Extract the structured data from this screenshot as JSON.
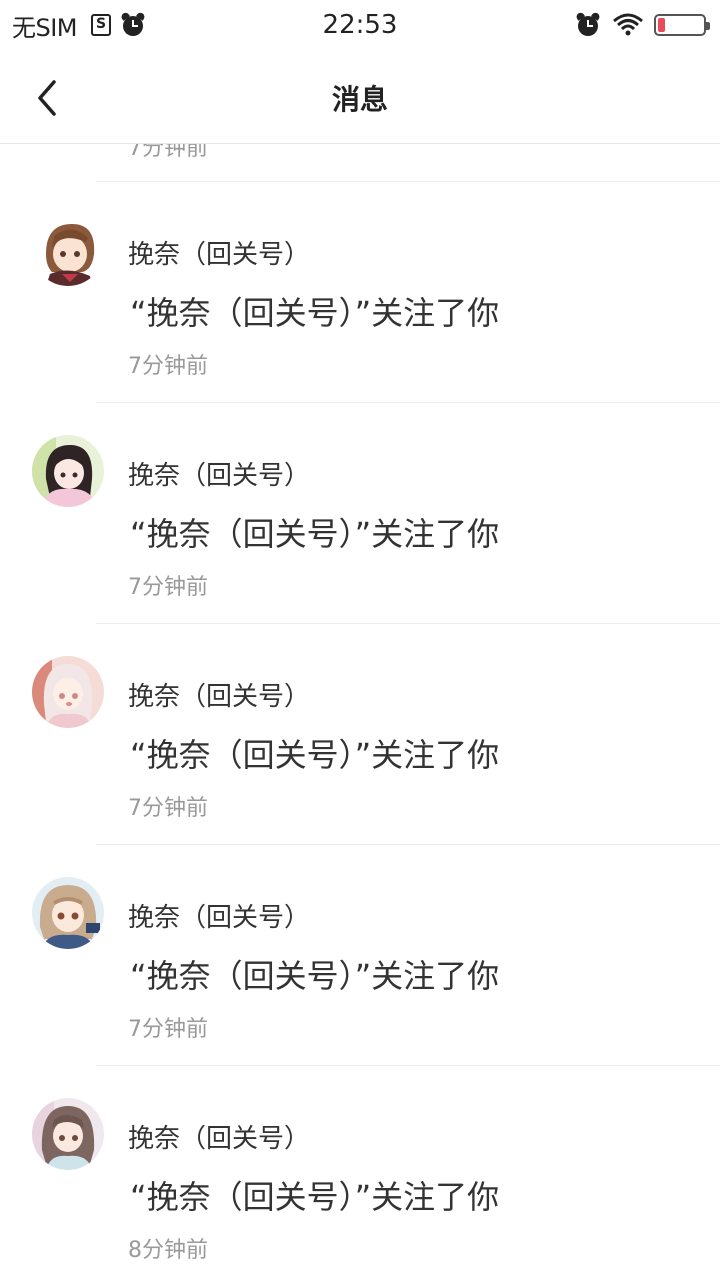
{
  "status_bar": {
    "carrier": "无SIM",
    "s_icon_label": "S",
    "time": "22:53",
    "battery_level": 0.15,
    "colors": {
      "battery_fill": "#e94b5b"
    }
  },
  "header": {
    "title": "消息",
    "back_icon": "chevron-left-icon"
  },
  "partial_item": {
    "time": "7分钟前"
  },
  "messages": [
    {
      "name": "挽奈（回关号）",
      "text": "“挽奈（回关号）”关注了你",
      "time": "7分钟前"
    },
    {
      "name": "挽奈（回关号）",
      "text": "“挽奈（回关号）”关注了你",
      "time": "7分钟前"
    },
    {
      "name": "挽奈（回关号）",
      "text": "“挽奈（回关号）”关注了你",
      "time": "7分钟前"
    },
    {
      "name": "挽奈（回关号）",
      "text": "“挽奈（回关号）”关注了你",
      "time": "7分钟前"
    },
    {
      "name": "挽奈（回关号）",
      "text": "“挽奈（回关号）”关注了你",
      "time": "8分钟前"
    }
  ]
}
